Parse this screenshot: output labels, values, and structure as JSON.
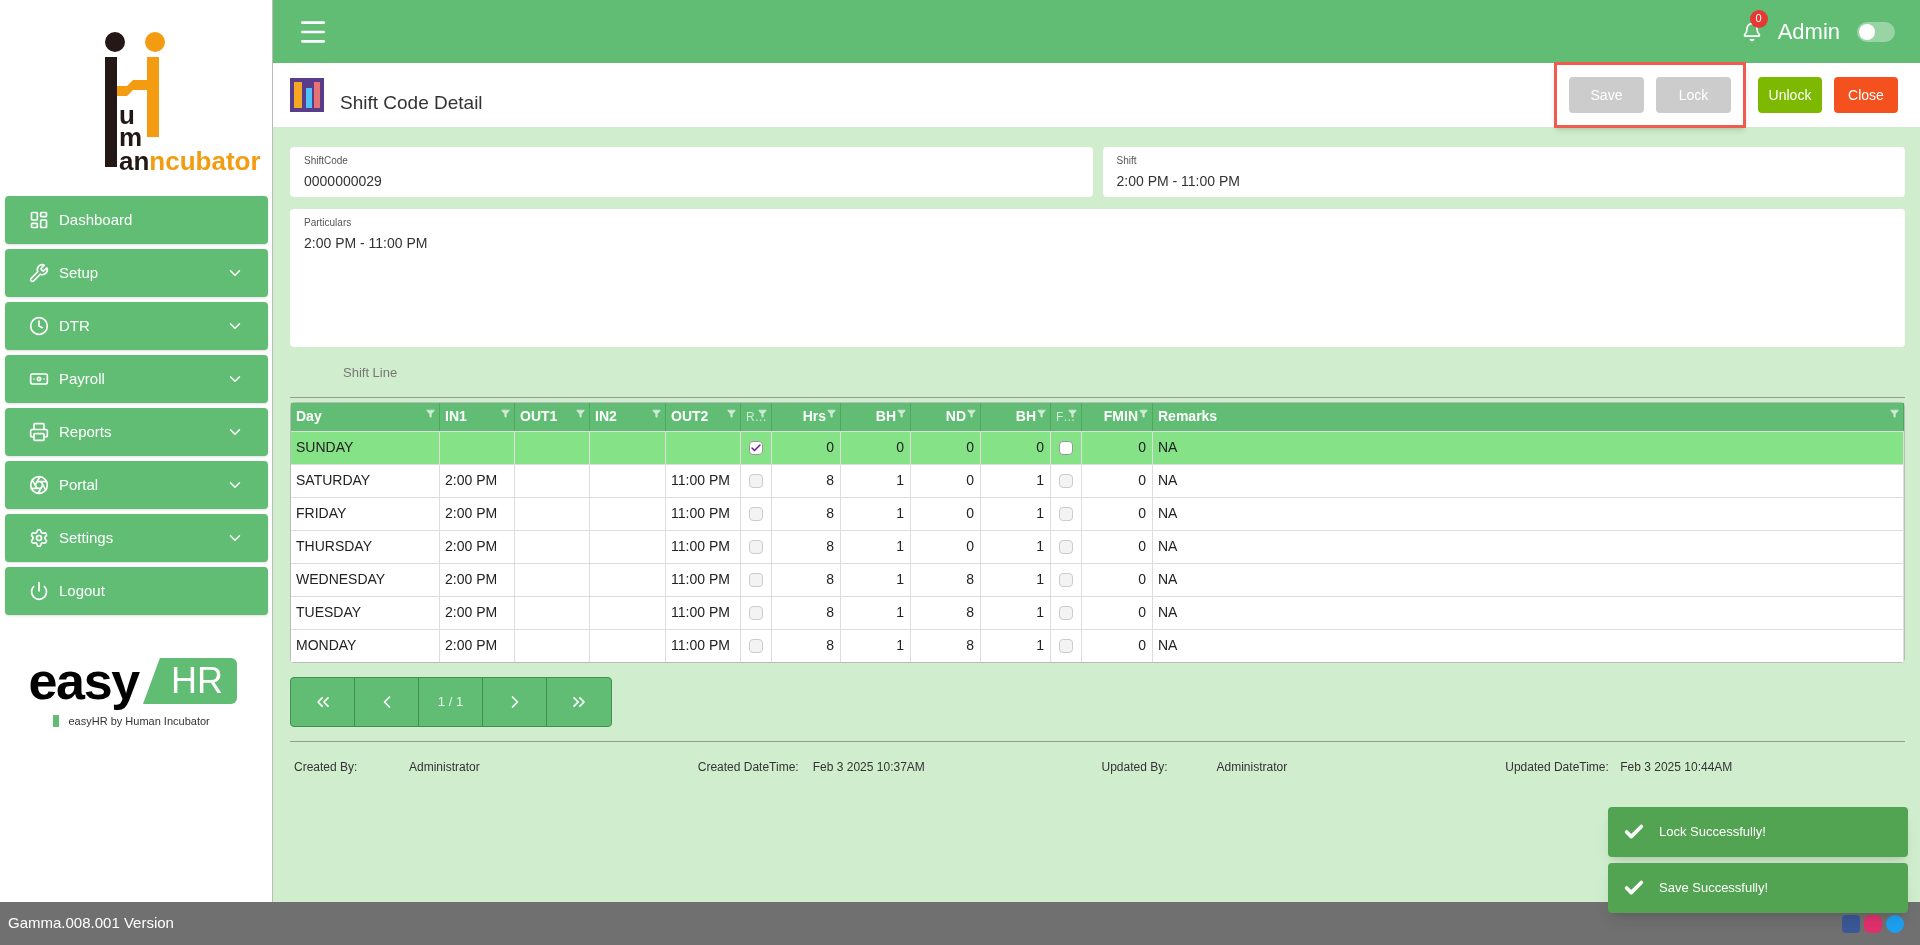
{
  "logo": {
    "stack": [
      "u",
      "m"
    ],
    "base_dark": "an",
    "base_light": "ncubator"
  },
  "sidebar": {
    "items": [
      {
        "label": "Dashboard",
        "expandable": false
      },
      {
        "label": "Setup",
        "expandable": true
      },
      {
        "label": "DTR",
        "expandable": true
      },
      {
        "label": "Payroll",
        "expandable": true
      },
      {
        "label": "Reports",
        "expandable": true
      },
      {
        "label": "Portal",
        "expandable": true
      },
      {
        "label": "Settings",
        "expandable": true
      },
      {
        "label": "Logout",
        "expandable": false
      }
    ]
  },
  "brand": {
    "word": "easy",
    "badge": "HR",
    "tagline": "easyHR by Human Incubator"
  },
  "header": {
    "notification_count": "0",
    "user": "Admin"
  },
  "page": {
    "title": "Shift Code Detail"
  },
  "buttons": [
    {
      "label": "Save",
      "kind": "save",
      "disabled": true
    },
    {
      "label": "Lock",
      "kind": "lock",
      "disabled": true
    },
    {
      "label": "Unlock",
      "kind": "unlock",
      "disabled": false
    },
    {
      "label": "Close",
      "kind": "close",
      "disabled": false
    }
  ],
  "fields": [
    {
      "label": "ShiftCode",
      "value": "0000000029"
    },
    {
      "label": "Shift",
      "value": "2:00 PM - 11:00 PM"
    }
  ],
  "particulars": {
    "label": "Particulars",
    "value": "2:00 PM - 11:00 PM"
  },
  "section_label": "Shift Line",
  "table": {
    "columns": [
      {
        "label": "Day",
        "kind": "text"
      },
      {
        "label": "IN1",
        "kind": "text"
      },
      {
        "label": "OUT1",
        "kind": "text"
      },
      {
        "label": "IN2",
        "kind": "text"
      },
      {
        "label": "OUT2",
        "kind": "text"
      },
      {
        "label": "R…",
        "kind": "check"
      },
      {
        "label": "Hrs",
        "kind": "number"
      },
      {
        "label": "BH",
        "kind": "number"
      },
      {
        "label": "ND",
        "kind": "number"
      },
      {
        "label": "BH",
        "kind": "number"
      },
      {
        "label": "F…",
        "kind": "check"
      },
      {
        "label": "FMIN",
        "kind": "number"
      },
      {
        "label": "Remarks",
        "kind": "text"
      }
    ],
    "rows": [
      {
        "selected": true,
        "cells": [
          "SUNDAY",
          "",
          "",
          "",
          "",
          {
            "checked": true,
            "disabled": false
          },
          "0",
          "0",
          "0",
          "0",
          {
            "checked": false,
            "disabled": false
          },
          "0",
          "NA"
        ]
      },
      {
        "selected": false,
        "cells": [
          "SATURDAY",
          "2:00 PM",
          "",
          "",
          "11:00 PM",
          {
            "checked": false,
            "disabled": true
          },
          "8",
          "1",
          "0",
          "1",
          {
            "checked": false,
            "disabled": true
          },
          "0",
          "NA"
        ]
      },
      {
        "selected": false,
        "cells": [
          "FRIDAY",
          "2:00 PM",
          "",
          "",
          "11:00 PM",
          {
            "checked": false,
            "disabled": true
          },
          "8",
          "1",
          "0",
          "1",
          {
            "checked": false,
            "disabled": true
          },
          "0",
          "NA"
        ]
      },
      {
        "selected": false,
        "cells": [
          "THURSDAY",
          "2:00 PM",
          "",
          "",
          "11:00 PM",
          {
            "checked": false,
            "disabled": true
          },
          "8",
          "1",
          "0",
          "1",
          {
            "checked": false,
            "disabled": true
          },
          "0",
          "NA"
        ]
      },
      {
        "selected": false,
        "cells": [
          "WEDNESDAY",
          "2:00 PM",
          "",
          "",
          "11:00 PM",
          {
            "checked": false,
            "disabled": true
          },
          "8",
          "1",
          "8",
          "1",
          {
            "checked": false,
            "disabled": true
          },
          "0",
          "NA"
        ]
      },
      {
        "selected": false,
        "cells": [
          "TUESDAY",
          "2:00 PM",
          "",
          "",
          "11:00 PM",
          {
            "checked": false,
            "disabled": true
          },
          "8",
          "1",
          "8",
          "1",
          {
            "checked": false,
            "disabled": true
          },
          "0",
          "NA"
        ]
      },
      {
        "selected": false,
        "cells": [
          "MONDAY",
          "2:00 PM",
          "",
          "",
          "11:00 PM",
          {
            "checked": false,
            "disabled": true
          },
          "8",
          "1",
          "8",
          "1",
          {
            "checked": false,
            "disabled": true
          },
          "0",
          "NA"
        ]
      }
    ]
  },
  "pager": {
    "page": "1 / 1"
  },
  "audit": [
    {
      "label": "Created By:",
      "value": "Administrator"
    },
    {
      "label": "Created DateTime:",
      "value": "Feb 3 2025 10:37AM"
    },
    {
      "label": "Updated By:",
      "value": "Administrator"
    },
    {
      "label": "Updated DateTime:",
      "value": "Feb 3 2025 10:44AM"
    }
  ],
  "toasts": [
    "Lock Successfully!",
    "Save Successfully!"
  ],
  "status_bar": {
    "version": "Gamma.008.001 Version"
  }
}
